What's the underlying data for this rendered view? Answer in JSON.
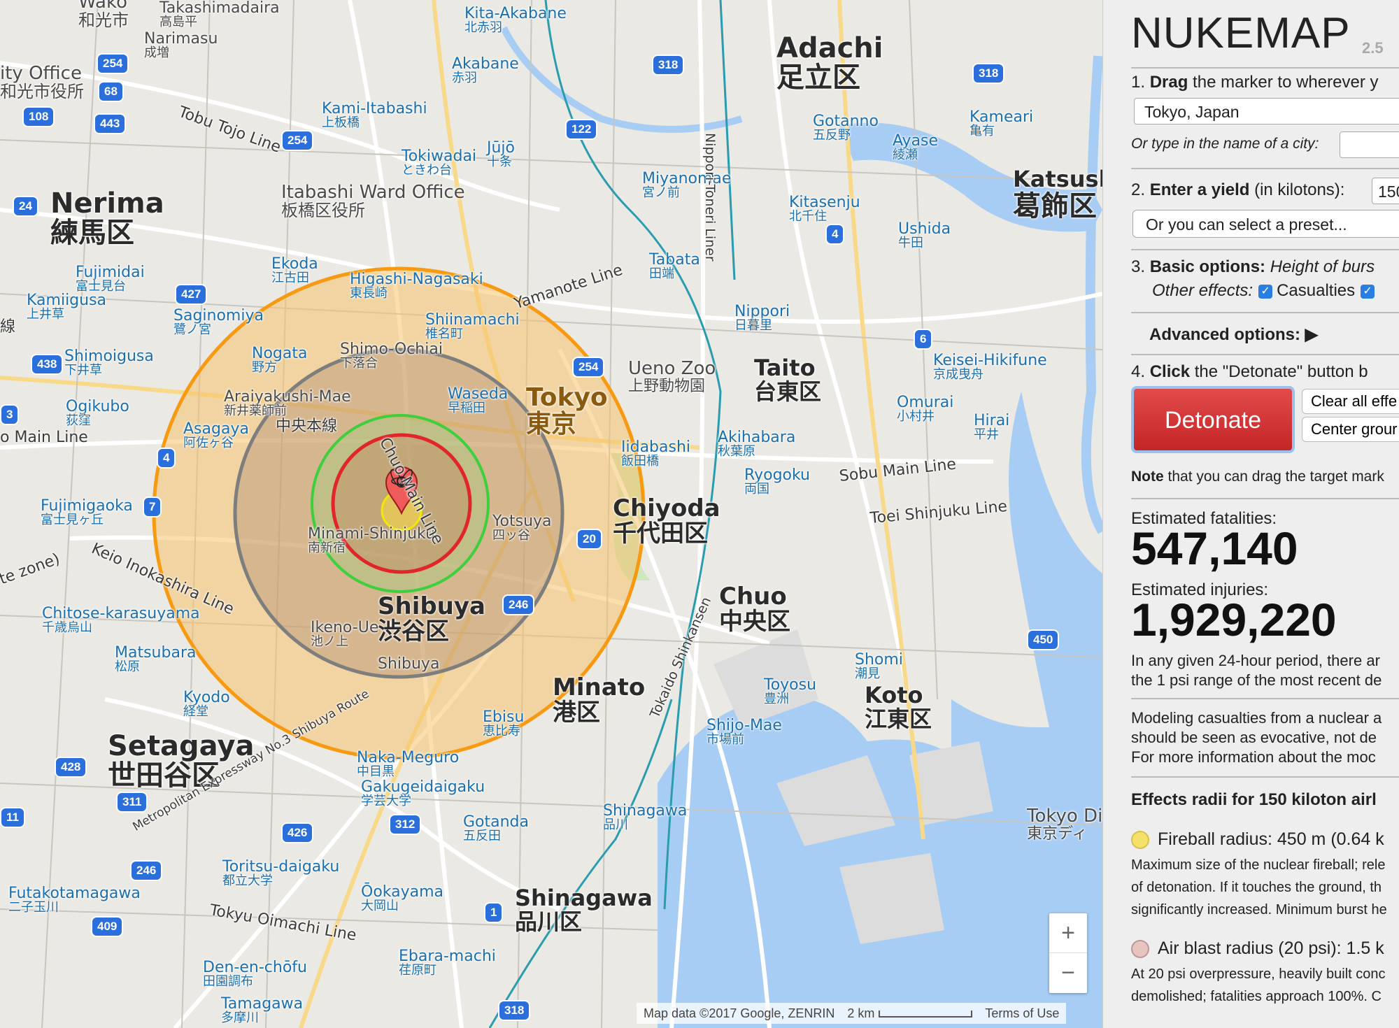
{
  "map": {
    "districts": [
      {
        "en": "Nerima",
        "jp": "練馬区"
      },
      {
        "en": "Adachi",
        "jp": "足立区"
      },
      {
        "en": "Katsushi",
        "jp": "葛飾区"
      },
      {
        "en": "Taito",
        "jp": "台東区"
      },
      {
        "en": "Tokyo",
        "jp": "東京"
      },
      {
        "en": "Chiyoda",
        "jp": "千代田区"
      },
      {
        "en": "Chuo",
        "jp": "中央区"
      },
      {
        "en": "Shibuya",
        "jp": "渋谷区"
      },
      {
        "en": "Minato",
        "jp": "港区"
      },
      {
        "en": "Koto",
        "jp": "江東区"
      },
      {
        "en": "Setagaya",
        "jp": "世田谷区"
      },
      {
        "en": "Shinagawa",
        "jp": "品川区"
      }
    ],
    "places": [
      {
        "en": "Takashimadaira",
        "jp": "高島平"
      },
      {
        "en": "Narimasu",
        "jp": "成増"
      },
      {
        "en": "Kita-Akabane",
        "jp": "北赤羽"
      },
      {
        "en": "Akabane",
        "jp": "赤羽"
      },
      {
        "en": "Kami-Itabashi",
        "jp": "上板橋"
      },
      {
        "en": "Tokiwadai",
        "jp": "ときわ台"
      },
      {
        "en": "Jūjō",
        "jp": "十条"
      },
      {
        "en": "Itabashi Ward Office",
        "jp": "板橋区役所"
      },
      {
        "en": "Miyanomae",
        "jp": "宮ノ前"
      },
      {
        "en": "Gotanno",
        "jp": "五反野"
      },
      {
        "en": "Ayase",
        "jp": "綾瀬"
      },
      {
        "en": "Kameari",
        "jp": "亀有"
      },
      {
        "en": "Kitasenju",
        "jp": "北千住"
      },
      {
        "en": "Ushida",
        "jp": "牛田"
      },
      {
        "en": "Fujimidai",
        "jp": "富士見台"
      },
      {
        "en": "Kamiigusa",
        "jp": "上井草"
      },
      {
        "en": "Ekoda",
        "jp": "江古田"
      },
      {
        "en": "Higashi-Nagasaki",
        "jp": "東長崎"
      },
      {
        "en": "Tabata",
        "jp": "田端"
      },
      {
        "en": "Saginomiya",
        "jp": "鷺ノ宮"
      },
      {
        "en": "Shiinamachi",
        "jp": "椎名町"
      },
      {
        "en": "Nippori",
        "jp": "日暮里"
      },
      {
        "en": "Shimoigusa",
        "jp": "下井草"
      },
      {
        "en": "Nogata",
        "jp": "野方"
      },
      {
        "en": "Shimo-Ochiai",
        "jp": "下落合"
      },
      {
        "en": "Ueno Zoo",
        "jp": "上野動物園"
      },
      {
        "en": "Keisei-Hikifune",
        "jp": "京成曳舟"
      },
      {
        "en": "Ogikubo",
        "jp": "荻窪"
      },
      {
        "en": "Araiyakushi-Mae",
        "jp": "新井薬師前"
      },
      {
        "en": "Waseda",
        "jp": "早稲田"
      },
      {
        "en": "Omurai",
        "jp": "小村井"
      },
      {
        "en": "Asagaya",
        "jp": "阿佐ヶ谷"
      },
      {
        "en": "Iidabashi",
        "jp": "飯田橋"
      },
      {
        "en": "Akihabara",
        "jp": "秋葉原"
      },
      {
        "en": "Hirai",
        "jp": "平井"
      },
      {
        "en": "Ryogoku",
        "jp": "両国"
      },
      {
        "en": "Fujimigaoka",
        "jp": "富士見ヶ丘"
      },
      {
        "en": "Yotsuya",
        "jp": "四ッ谷"
      },
      {
        "en": "Minami-Shinjuku",
        "jp": "南新宿"
      },
      {
        "en": "Chitose-karasuyama",
        "jp": "千歳烏山"
      },
      {
        "en": "Ikeno-Ue",
        "jp": "池ノ上"
      },
      {
        "en": "Matsubara",
        "jp": "松原"
      },
      {
        "en": "Shomi",
        "jp": "潮見"
      },
      {
        "en": "Toyosu",
        "jp": "豊洲"
      },
      {
        "en": "Kyodo",
        "jp": "経堂"
      },
      {
        "en": "Shibuya",
        "jp": ""
      },
      {
        "en": "Ebisu",
        "jp": "恵比寿"
      },
      {
        "en": "Shijo-Mae",
        "jp": "市場前"
      },
      {
        "en": "Naka-Meguro",
        "jp": "中目黒"
      },
      {
        "en": "Gakugeidaigaku",
        "jp": "学芸大学"
      },
      {
        "en": "Shinagawa",
        "jp": "品川"
      },
      {
        "en": "Gotanda",
        "jp": "五反田"
      },
      {
        "en": "Futakotamagawa",
        "jp": "二子玉川"
      },
      {
        "en": "Toritsu-daigaku",
        "jp": "都立大学"
      },
      {
        "en": "Ōokayama",
        "jp": "大岡山"
      },
      {
        "en": "Den-en-chōfu",
        "jp": "田園調布"
      },
      {
        "en": "Ebara-machi",
        "jp": "荏原町"
      },
      {
        "en": "Tamagawa",
        "jp": "多摩川"
      },
      {
        "en": "Tokyo Di",
        "jp": "東京ディ"
      },
      {
        "en": "ity Office",
        "jp": "和光市役所"
      },
      {
        "en": "Wako",
        "jp": "和光市"
      }
    ],
    "lines": [
      "Tobu Tojo Line",
      "Yamanote Line",
      "Chuo Main Line",
      "Keio Inokashira Line",
      "Sobu Main Line",
      "Toei Shinjuku Line",
      "Tokyu Oimachi Line",
      "Metropolitan Expressway No.3 Shibuya Route",
      "Tokaido Shinkansen",
      "Nippori-Toneri Liner",
      "中央本線",
      "o Main Line",
      "te zone)",
      "線"
    ],
    "route_shields": [
      "254",
      "68",
      "108",
      "443",
      "254",
      "318",
      "122",
      "318",
      "24",
      "427",
      "438",
      "254",
      "4",
      "6",
      "3",
      "4",
      "20",
      "246",
      "7",
      "428",
      "311",
      "426",
      "312",
      "246",
      "409",
      "450",
      "1",
      "318",
      "11"
    ],
    "zoom_in": "+",
    "zoom_out": "−",
    "attribution": "Map data ©2017 Google, ZENRIN",
    "scale": "2 km",
    "terms": "Terms of Use"
  },
  "panel": {
    "title": "NUKEMAP",
    "version": "2.5",
    "step1_num": "1.",
    "step1_bold": "Drag",
    "step1_text": "the marker to wherever y",
    "location_value": "Tokyo, Japan",
    "city_prompt": "Or type in the name of a city:",
    "step2_num": "2.",
    "step2_bold": "Enter a yield",
    "step2_text": "(in kilotons):",
    "yield_value": "150",
    "preset_label": "Or you can select a preset...",
    "step3_num": "3.",
    "step3_bold": "Basic options:",
    "step3_text": "Height of burs",
    "other_effects": "Other effects:",
    "casualties_label": "Casualties",
    "advanced_label": "Advanced options: ▶",
    "step4_num": "4.",
    "step4_bold": "Click",
    "step4_text": "the \"Detonate\" button b",
    "detonate_label": "Detonate",
    "clear_label": "Clear all effe",
    "center_label": "Center grour",
    "note_bold": "Note",
    "note_text": "that you can drag the target mark",
    "fatalities_label": "Estimated fatalities:",
    "fatalities_value": "547,140",
    "injuries_label": "Estimated injuries:",
    "injuries_value": "1,929,220",
    "para1_l1": "In any given 24-hour period, there ar",
    "para1_l2": "the 1 psi range of the most recent de",
    "para2_l1": "Modeling casualties from a nuclear a",
    "para2_l2": "should be seen as evocative, not de",
    "para2_l3": "For more information about the moc",
    "effects_heading": "Effects radii for 150 kiloton airl",
    "fireball_title": "Fireball radius: 450 m (0.64 k",
    "fireball_d1": "Maximum size of the nuclear fireball; rele",
    "fireball_d2": "of detonation. If it touches the ground, th",
    "fireball_d3": "significantly increased. Minimum burst he",
    "airblast_title": "Air blast radius (20 psi): 1.5 k",
    "airblast_d1": "At 20 psi overpressure, heavily built conc",
    "airblast_d2": "demolished; fatalities approach 100%. C",
    "colors": {
      "fireball": "#f4e06a",
      "airblast": "#e8c4c0",
      "detonate": "#d33b3b",
      "check": "#2a7de1"
    }
  }
}
